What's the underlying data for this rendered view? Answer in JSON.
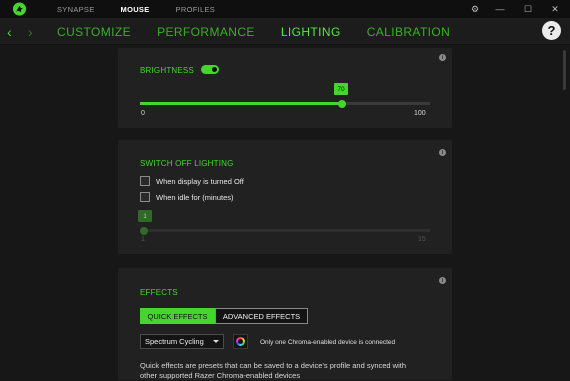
{
  "titlebar": {
    "tabs": [
      {
        "label": "SYNAPSE"
      },
      {
        "label": "MOUSE"
      },
      {
        "label": "PROFILES"
      }
    ],
    "controls": {
      "settings": "⚙",
      "minimize": "—",
      "maximize": "☐",
      "close": "✕"
    },
    "logo_icon": "razer-snake-logo"
  },
  "subnav": {
    "back": "‹",
    "forward": "›",
    "tabs": [
      {
        "label": "CUSTOMIZE"
      },
      {
        "label": "PERFORMANCE"
      },
      {
        "label": "LIGHTING"
      },
      {
        "label": "CALIBRATION"
      }
    ],
    "active_tab": "LIGHTING",
    "help": "?"
  },
  "brightness": {
    "title": "BRIGHTNESS",
    "enabled": true,
    "value": "70",
    "min": "0",
    "max": "100",
    "info": "i"
  },
  "switch_off": {
    "title": "SWITCH OFF LIGHTING",
    "option_display": "When display is turned Off",
    "option_idle": "When idle for (minutes)",
    "idle_value": "1",
    "idle_min": "1",
    "idle_max": "15",
    "info": "i"
  },
  "effects": {
    "title": "EFFECTS",
    "quick_label": "QUICK EFFECTS",
    "advanced_label": "ADVANCED EFFECTS",
    "selected_effect": "Spectrum Cycling",
    "device_note": "Only one Chroma-enabled device is connected",
    "description": "Quick effects are presets that can be saved to a device's profile and synced with other supported Razer Chroma-enabled devices",
    "info": "i"
  },
  "colors": {
    "accent": "#44d62c",
    "background": "#171717",
    "card": "#212121"
  }
}
